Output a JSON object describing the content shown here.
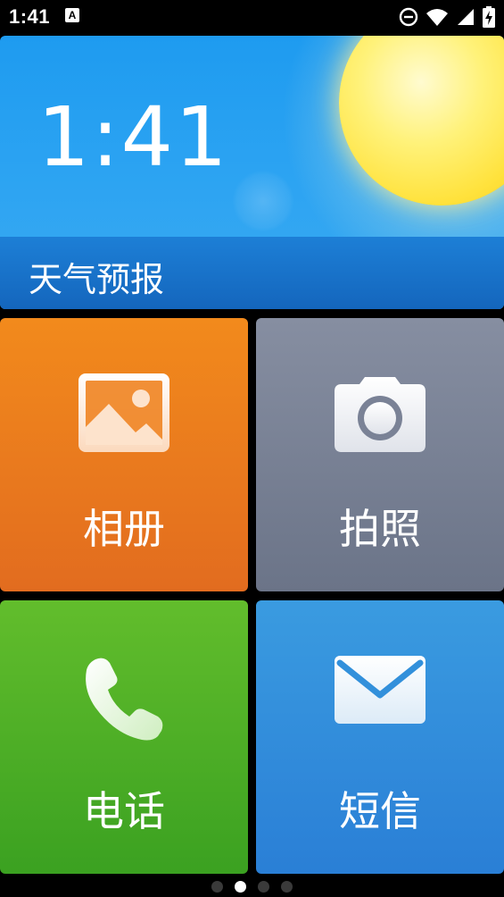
{
  "status_bar": {
    "time": "1:41",
    "notification_icon": "A",
    "icons": [
      "do-not-disturb-icon",
      "wifi-icon",
      "signal-icon",
      "battery-charging-icon"
    ]
  },
  "weather_widget": {
    "time": "1:41",
    "label": "天气预报",
    "colors": {
      "sky": "#1e9bf0",
      "banner": "#1466bd",
      "sun": "#ffe23c"
    }
  },
  "tiles": [
    {
      "label": "相册",
      "icon": "gallery-icon",
      "color": "#ee7d1d"
    },
    {
      "label": "拍照",
      "icon": "camera-icon",
      "color": "#7a8296"
    },
    {
      "label": "电话",
      "icon": "phone-icon",
      "color": "#4fae26"
    },
    {
      "label": "短信",
      "icon": "message-icon",
      "color": "#3290db"
    }
  ],
  "page_indicator": {
    "count": 4,
    "active": 2
  }
}
